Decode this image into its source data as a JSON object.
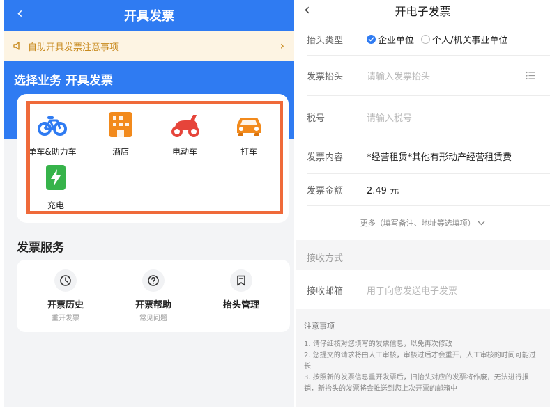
{
  "left": {
    "nav": {
      "back_icon": "chevron-left-icon",
      "title": "开具发票"
    },
    "notice": {
      "text": "自助开具发票注意事项",
      "icon": "speaker-icon",
      "color": "#c88a1e"
    },
    "business": {
      "title": "选择业务 开具发票",
      "items": [
        {
          "label": "单车&助力车",
          "icon": "bicycle-icon"
        },
        {
          "label": "酒店",
          "icon": "hotel-icon"
        },
        {
          "label": "电动车",
          "icon": "scooter-icon"
        },
        {
          "label": "打车",
          "icon": "taxi-icon"
        },
        {
          "label": "充电",
          "icon": "battery-charge-icon"
        }
      ]
    },
    "services": {
      "title": "发票服务",
      "items": [
        {
          "label": "开票历史",
          "sub": "重开发票",
          "icon": "clock-icon"
        },
        {
          "label": "开票帮助",
          "sub": "常见问题",
          "icon": "help-icon"
        },
        {
          "label": "抬头管理",
          "sub": "",
          "icon": "bookmark-icon"
        }
      ]
    },
    "colors": {
      "brand": "#2f7bf2",
      "highlight_frame": "#ef6a3a"
    }
  },
  "right": {
    "nav": {
      "back_icon": "chevron-left-icon",
      "title": "开电子发票"
    },
    "header_type": {
      "label": "抬头类型",
      "options": [
        {
          "label": "企业单位",
          "selected": true
        },
        {
          "label": "个人/机关事业单位",
          "selected": false
        }
      ]
    },
    "invoice_title": {
      "label": "发票抬头",
      "placeholder": "请输入发票抬头"
    },
    "tax_no": {
      "label": "税号",
      "placeholder": "请输入税号"
    },
    "content": {
      "label": "发票内容",
      "value": "*经营租赁*其他有形动产经营租赁费"
    },
    "amount": {
      "label": "发票金额",
      "value": "2.49 元"
    },
    "more": "更多（填写备注、地址等选填项）",
    "receive": {
      "section": "接收方式",
      "email_label": "接收邮箱",
      "email_placeholder": "用于向您发送电子发票"
    },
    "notes": {
      "title": "注意事项",
      "items": [
        "1. 请仔细核对您填写的发票信息，以免再次修改",
        "2. 您提交的请求将由人工审核，审核过后才会重开，人工审核的时间可能过长",
        "3. 按照新的发票信息重开发票后，旧抬头对应的发票将作废，无法进行报销，新抬头的发票将会推送到您上次开票的邮箱中"
      ]
    }
  }
}
